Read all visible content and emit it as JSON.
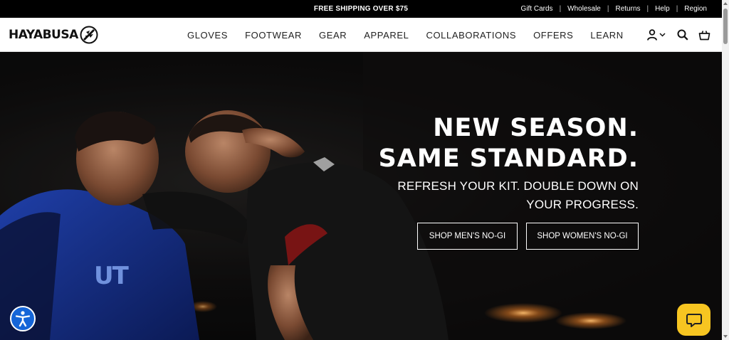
{
  "announcement": {
    "text": "FREE SHIPPING OVER $75"
  },
  "utility_links": [
    "Gift Cards",
    "Wholesale",
    "Returns",
    "Help",
    "Region"
  ],
  "brand": {
    "name": "HAYABUSA"
  },
  "nav": [
    "GLOVES",
    "FOOTWEAR",
    "GEAR",
    "APPAREL",
    "COLLABORATIONS",
    "OFFERS",
    "LEARN"
  ],
  "header_icons": [
    "account-icon",
    "chevron-down-icon",
    "search-icon",
    "cart-icon"
  ],
  "hero": {
    "headline_line1": "NEW SEASON.",
    "headline_line2": "SAME STANDARD.",
    "subheading": "REFRESH YOUR KIT. DOUBLE DOWN ON YOUR PROGRESS.",
    "cta_men": "SHOP MEN'S NO-GI",
    "cta_women": "SHOP WOMEN'S NO-GI",
    "shirt_print": "UT"
  },
  "colors": {
    "accent_chat": "#f7c521",
    "accessibility_blue": "#1565d8",
    "topbar": "#000000"
  }
}
